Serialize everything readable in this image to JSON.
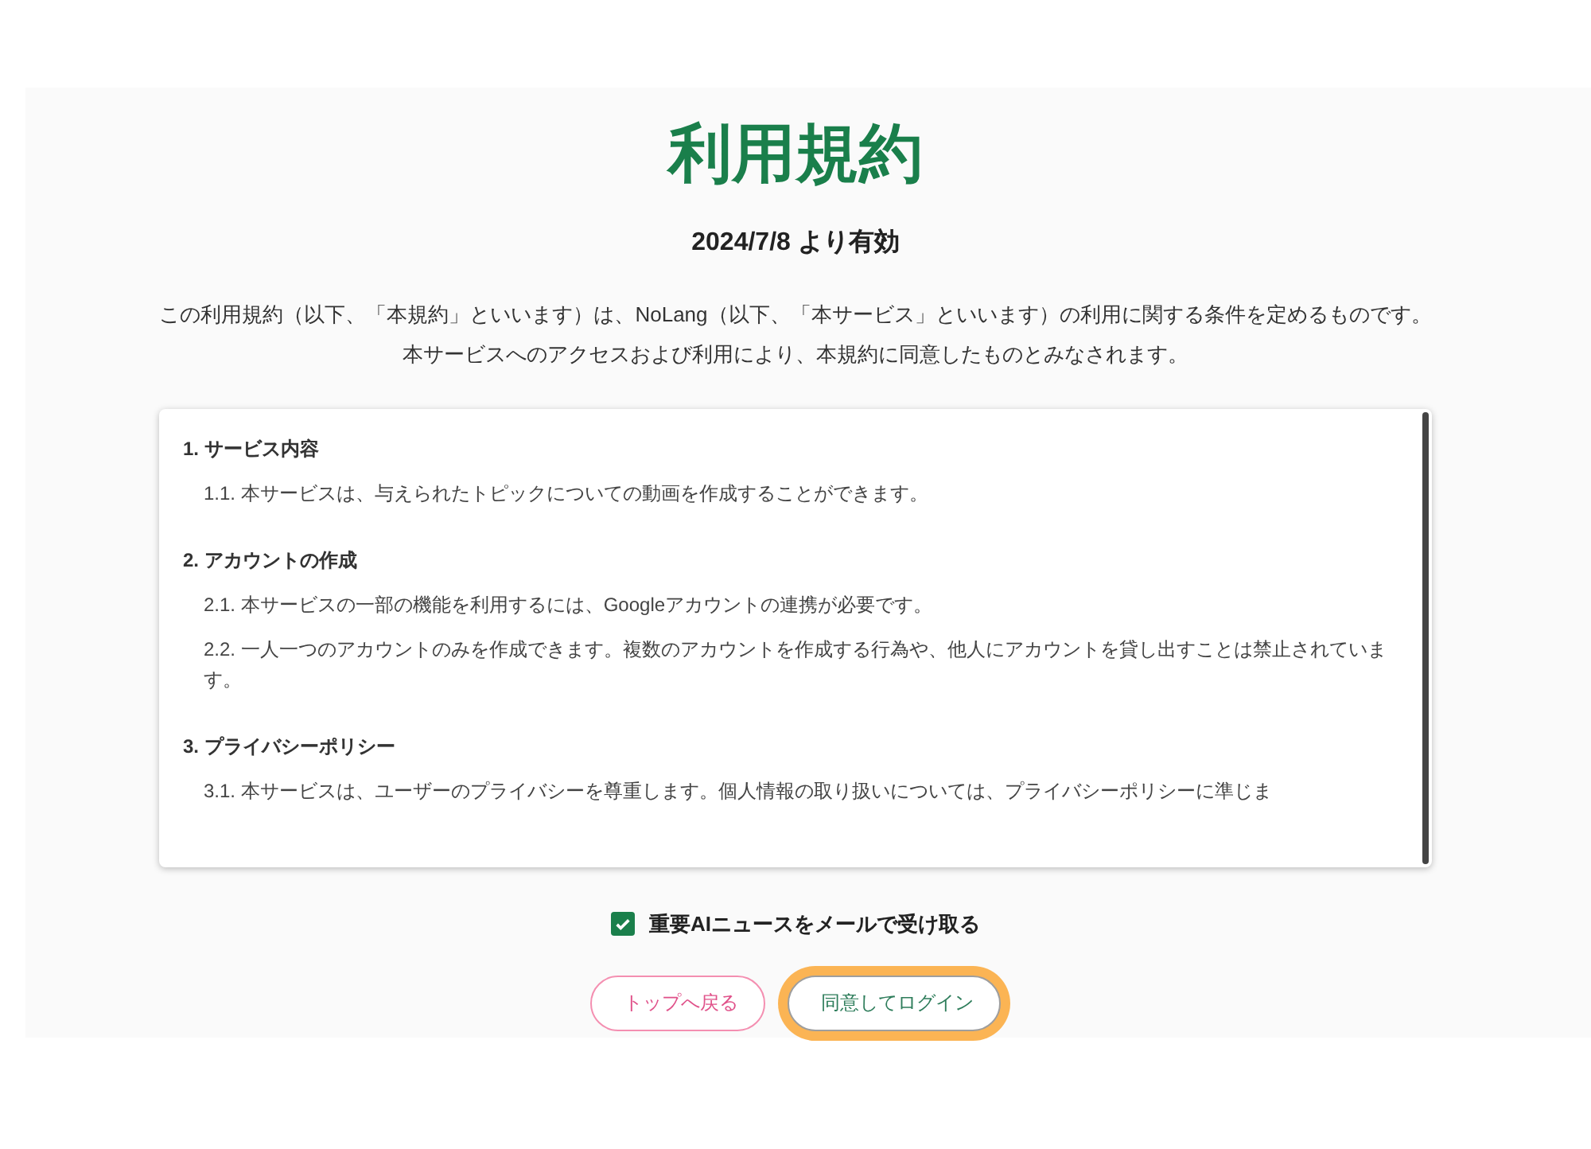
{
  "title": "利用規約",
  "effective_date": "2024/7/8 より有効",
  "intro": [
    "この利用規約（以下、「本規約」といいます）は、NoLang（以下、「本サービス」といいます）の利用に関する条件を定めるものです。",
    "本サービスへのアクセスおよび利用により、本規約に同意したものとみなされます。"
  ],
  "sections": [
    {
      "heading": "1. サービス内容",
      "clauses": [
        "1.1. 本サービスは、与えられたトピックについての動画を作成することができます。"
      ]
    },
    {
      "heading": "2. アカウントの作成",
      "clauses": [
        "2.1. 本サービスの一部の機能を利用するには、Googleアカウントの連携が必要です。",
        "2.2. 一人一つのアカウントのみを作成できます。複数のアカウントを作成する行為や、他人にアカウントを貸し出すことは禁止されています。"
      ]
    },
    {
      "heading": "3. プライバシーポリシー",
      "clauses": [
        "3.1. 本サービスは、ユーザーのプライバシーを尊重します。個人情報の取り扱いについては、プライバシーポリシーに準じま"
      ]
    }
  ],
  "newsletter": {
    "label": "重要AIニュースをメールで受け取る",
    "checked": true
  },
  "buttons": [
    {
      "label": "トップへ戻る",
      "kind": "secondary",
      "highlighted": false
    },
    {
      "label": "同意してログイン",
      "kind": "primary",
      "highlighted": true
    }
  ]
}
